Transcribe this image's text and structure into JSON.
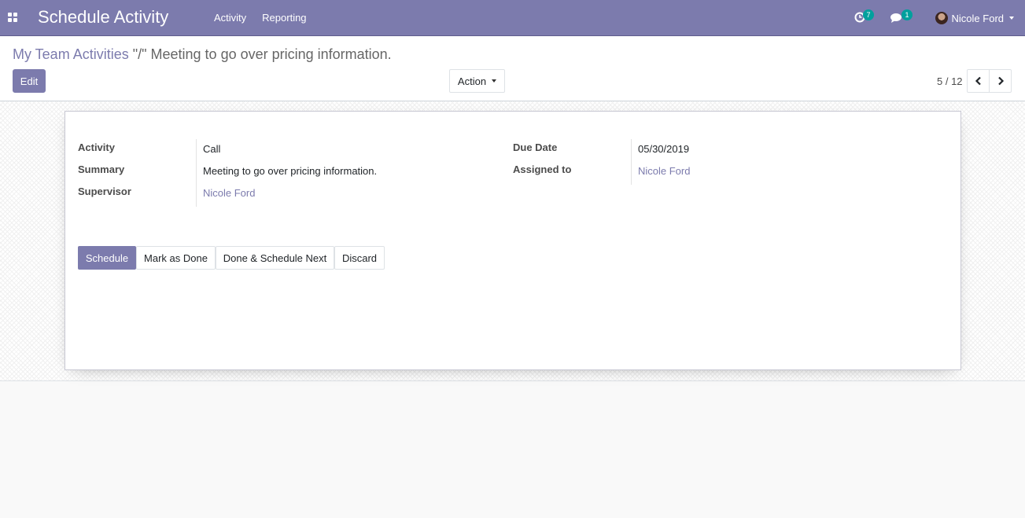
{
  "navbar": {
    "app_title": "Schedule Activity",
    "menu": [
      "Activity",
      "Reporting"
    ],
    "activity_badge": "7",
    "messages_badge": "1",
    "user_name": "Nicole Ford",
    "bg_color": "#7c7bad"
  },
  "control_panel": {
    "breadcrumb_parent": "My Team Activities",
    "breadcrumb_current": "\"/\" Meeting to go over pricing information.",
    "edit_label": "Edit",
    "action_label": "Action",
    "pager_value": "5 / 12"
  },
  "form": {
    "left": [
      {
        "label": "Activity",
        "value": "Call"
      },
      {
        "label": "Summary",
        "value": "Meeting to go over pricing information."
      },
      {
        "label": "Supervisor",
        "value": "Nicole Ford"
      }
    ],
    "right": [
      {
        "label": "Due Date",
        "value": "05/30/2019"
      },
      {
        "label": "Assigned to",
        "value": "Nicole Ford"
      }
    ]
  },
  "footer": {
    "schedule": "Schedule",
    "mark_done": "Mark as Done",
    "done_schedule_next": "Done & Schedule Next",
    "discard": "Discard"
  },
  "colors": {
    "accent": "#7c7bad",
    "badge": "#00a09d"
  }
}
